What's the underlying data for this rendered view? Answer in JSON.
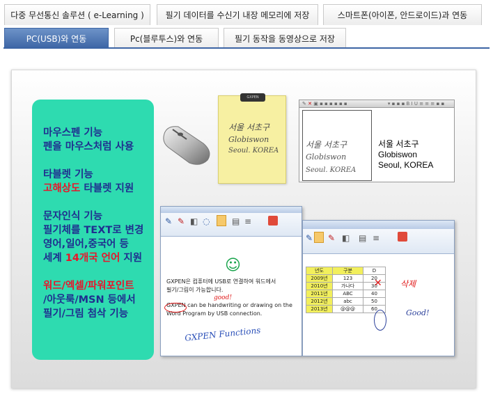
{
  "tabs_row1": [
    {
      "label": "다중 무선통신 솔루션 ( e-Learning )"
    },
    {
      "label": "필기 데이터를 수신기 내장 메모리에 저장"
    },
    {
      "label": "스마트폰(아이폰, 안드로이드)과 연동"
    }
  ],
  "tabs_row2": [
    {
      "label": "PC(USB)와 연동",
      "active": true
    },
    {
      "label": "Pc(블루투스)와 연동"
    },
    {
      "label": "필기 동작을 동영상으로 저장"
    }
  ],
  "features": {
    "mouse_title": "마우스펜 기능",
    "mouse_desc": "펜을 마우스처럼 사용",
    "tablet_title": "타블렛 기능",
    "tablet_hl": "고해상도",
    "tablet_rest": " 타블렛 지원",
    "ocr_title": "문자인식 기능",
    "ocr_line1": "필기체를 TEXT로 변경",
    "ocr_line2": "영어,일어,중국어 등",
    "ocr_line3_pre": "세계 ",
    "ocr_line3_hl": "14개국 언어",
    "ocr_line3_post": " 지원",
    "office_line1": "워드/엑셀/파워포인트",
    "office_line2": "/아웃룩/MSN 등에서",
    "office_line3": "필기/그림 첨삭 기능"
  },
  "pad": {
    "hw1": "서울 서초구",
    "hw2": "Globiswon",
    "hw3": "Seoul. KOREA",
    "clip": "GXPEN"
  },
  "recognition": {
    "hw1": "서울 서초구",
    "hw2": "Globiswon",
    "hw3": "Seoul. KOREA",
    "typed1": "서울 서초구",
    "typed2": "Globiswon",
    "typed3": "Seoul, KOREA"
  },
  "word": {
    "body1": "GXPEN은 컴퓨터에 USB로 연결하여 워드에서",
    "body2": "필기/그림이 가능합니다.",
    "body3": "GXPEN can be handwriting or drawing on the",
    "body4": "Word Program by USB connection.",
    "ann_good": "good!",
    "ann_func": "GXPEN Functions",
    "smiley": "☺"
  },
  "excel": {
    "headers": [
      "년도",
      "구분",
      "D"
    ],
    "rows": [
      [
        "2009년",
        "123",
        "20"
      ],
      [
        "2010년",
        "가나다",
        "30"
      ],
      [
        "2011년",
        "ABC",
        "40"
      ],
      [
        "2012년",
        "abc",
        "50"
      ],
      [
        "2013년",
        "@@@",
        "60"
      ]
    ],
    "ann_delete": "삭제",
    "ann_good": "Good!"
  },
  "colors": {
    "accent": "#3c64a4",
    "green_box": "#2edbb0",
    "text_blue": "#1f2f8f",
    "highlight_red": "#e8152a",
    "pad_yellow": "#f7f0a2"
  }
}
